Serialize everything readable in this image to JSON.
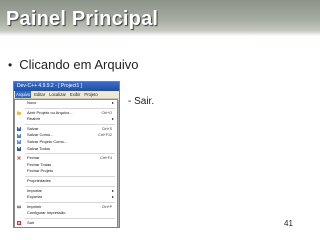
{
  "slide": {
    "title": "Painel Principal",
    "bullet": "Clicando em Arquivo",
    "note": "- Sair.",
    "page_number": "41"
  },
  "app": {
    "window_title": "Dev-C++ 4.9.9.2 - [ Project1 ]",
    "menubar": [
      "Arquivo",
      "Editar",
      "Localizar",
      "Exibir",
      "Projeto"
    ]
  },
  "file_menu": {
    "items": [
      {
        "label": "Novo",
        "shortcut": "",
        "submenu": true
      },
      {
        "label": "Abrir Projeto ou Arquivo...",
        "shortcut": "Ctrl+O",
        "submenu": false
      },
      {
        "label": "Reabrir",
        "shortcut": "",
        "submenu": true
      },
      {
        "label": "Salvar",
        "shortcut": "Ctrl+S",
        "submenu": false
      },
      {
        "label": "Salvar Como...",
        "shortcut": "Ctrl+F12",
        "submenu": false
      },
      {
        "label": "Salvar Projeto Como...",
        "shortcut": "",
        "submenu": false
      },
      {
        "label": "Salvar Todos",
        "shortcut": "",
        "submenu": false
      },
      {
        "label": "Fechar",
        "shortcut": "Ctrl+F4",
        "submenu": false
      },
      {
        "label": "Fechar Todas",
        "shortcut": "",
        "submenu": false
      },
      {
        "label": "Fechar Projeto",
        "shortcut": "",
        "submenu": false
      },
      {
        "label": "Propriedades",
        "shortcut": "",
        "submenu": false
      },
      {
        "label": "Importar",
        "shortcut": "",
        "submenu": true
      },
      {
        "label": "Exportar",
        "shortcut": "",
        "submenu": true
      },
      {
        "label": "Imprimir",
        "shortcut": "Ctrl+P",
        "submenu": false
      },
      {
        "label": "Configurar Impressão",
        "shortcut": "",
        "submenu": false
      },
      {
        "label": "Sair",
        "shortcut": "",
        "submenu": false
      }
    ]
  },
  "colors": {
    "header_band": "#a7aca3",
    "titlebar": "#2a5bb8",
    "menubar_active": "#316ac5"
  }
}
